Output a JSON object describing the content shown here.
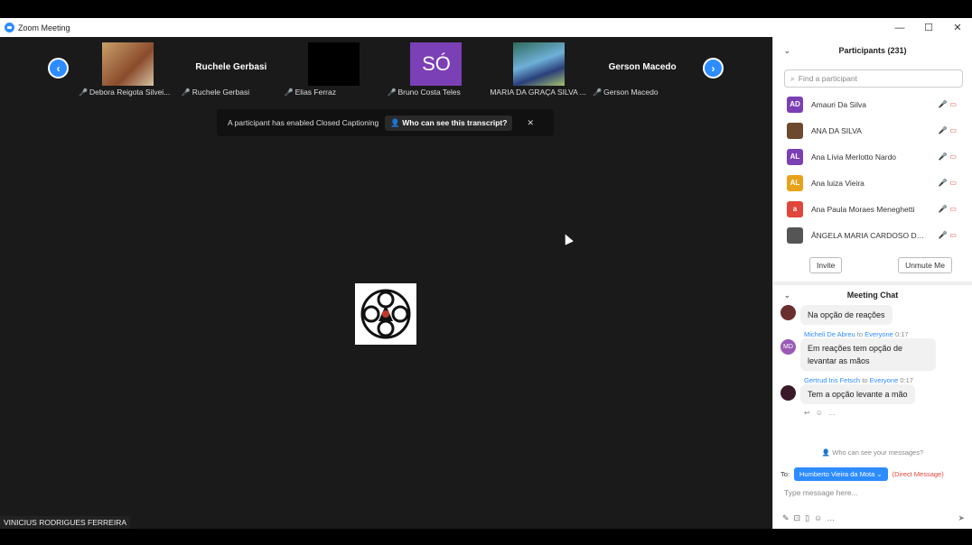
{
  "window": {
    "title": "Zoom Meeting",
    "minimize": "—",
    "maximize": "☐",
    "close": "✕"
  },
  "gallery": {
    "prev": "‹",
    "next": "›",
    "tiles": [
      {
        "name": "Debora Reigota Silvei...",
        "big_name": ""
      },
      {
        "name": "Ruchele Gerbasi",
        "big_name": "Ruchele Gerbasi"
      },
      {
        "name": "Elias Ferraz",
        "big_name": ""
      },
      {
        "name": "Bruno Costa Teles",
        "big_name": "",
        "avatar_text": "SÓ"
      },
      {
        "name": "MARIA DA GRAÇA SILVA ...",
        "big_name": ""
      },
      {
        "name": "Gerson Macedo",
        "big_name": "Gerson Macedo"
      }
    ]
  },
  "toast": {
    "text": "A participant has enabled Closed Captioning",
    "button": "Who can see this transcript?",
    "close": "✕"
  },
  "active_speaker": {
    "name": "VINICIUS RODRIGUES FERREIRA"
  },
  "participants": {
    "title": "Participants (231)",
    "search_placeholder": "Find a participant",
    "list": [
      {
        "initials": "AD",
        "name": "Amauri Da Silva",
        "color": "#7b3fb6"
      },
      {
        "initials": "",
        "name": "ANA DA SILVA",
        "color": "#6b4a2e"
      },
      {
        "initials": "AL",
        "name": "Ana Lívia Merlotto Nardo",
        "color": "#7b3fb6"
      },
      {
        "initials": "AL",
        "name": "Ana luiza Vieira",
        "color": "#e8a21a"
      },
      {
        "initials": "a",
        "name": "Ana Paula Moraes Meneghetti",
        "color": "#e0463a"
      },
      {
        "initials": "",
        "name": "ÂNGELA MARIA CARDOSO DE ...",
        "color": "#555555"
      }
    ],
    "invite": "Invite",
    "unmute_me": "Unmute Me"
  },
  "chat": {
    "title": "Meeting Chat",
    "messages": [
      {
        "sender": "",
        "to": "",
        "time": "",
        "text": "Na opção de reações",
        "initials": ""
      },
      {
        "sender": "Micheli De Abreu",
        "to": "Everyone",
        "time": "0:17",
        "text": "Em reações tem opção de levantar as mãos",
        "initials": "MD"
      },
      {
        "sender": "Gertrud Iris Fetsch",
        "to": "Everyone",
        "time": "0:17",
        "text": "Tem a opção levante a mão",
        "initials": ""
      }
    ],
    "to_word": "to",
    "who_can_see": "Who can see your messages?",
    "to_label": "To:",
    "recipient": "Humberto Vieira da Mota ⌄",
    "direct_message": "(Direct Message)",
    "placeholder": "Type message here..."
  }
}
